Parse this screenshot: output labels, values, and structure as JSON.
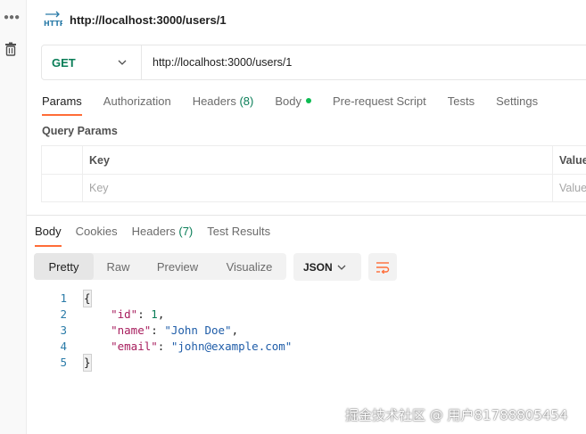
{
  "rail": {
    "more_icon": "ellipsis-icon",
    "trash_icon": "trash-icon"
  },
  "request": {
    "title": "http://localhost:3000/users/1",
    "method": "GET",
    "url": "http://localhost:3000/users/1"
  },
  "request_tabs": [
    {
      "label": "Params",
      "active": true
    },
    {
      "label": "Authorization"
    },
    {
      "label": "Headers",
      "count": "(8)"
    },
    {
      "label": "Body",
      "has_dot": true
    },
    {
      "label": "Pre-request Script"
    },
    {
      "label": "Tests"
    },
    {
      "label": "Settings"
    }
  ],
  "query_params": {
    "title": "Query Params",
    "col_key": "Key",
    "col_value": "Value",
    "placeholder_key": "Key",
    "placeholder_value": "Value"
  },
  "response_tabs": [
    {
      "label": "Body",
      "active": true
    },
    {
      "label": "Cookies"
    },
    {
      "label": "Headers",
      "count": "(7)"
    },
    {
      "label": "Test Results"
    }
  ],
  "view_modes": [
    "Pretty",
    "Raw",
    "Preview",
    "Visualize"
  ],
  "format": "JSON",
  "response_lines": [
    {
      "no": "1",
      "text": "{"
    },
    {
      "no": "2",
      "key": "\"id\"",
      "value": "1",
      "type": "n",
      "comma": ","
    },
    {
      "no": "3",
      "key": "\"name\"",
      "value": "\"John Doe\"",
      "type": "s",
      "comma": ","
    },
    {
      "no": "4",
      "key": "\"email\"",
      "value": "\"john@example.com\"",
      "type": "s",
      "comma": ""
    },
    {
      "no": "5",
      "text": "}"
    }
  ],
  "watermark": "掘金技术社区 @ 用户81788805454",
  "colors": {
    "accent": "#ff6c37",
    "method_get": "#097d57",
    "status_dot": "#0cbb52"
  }
}
